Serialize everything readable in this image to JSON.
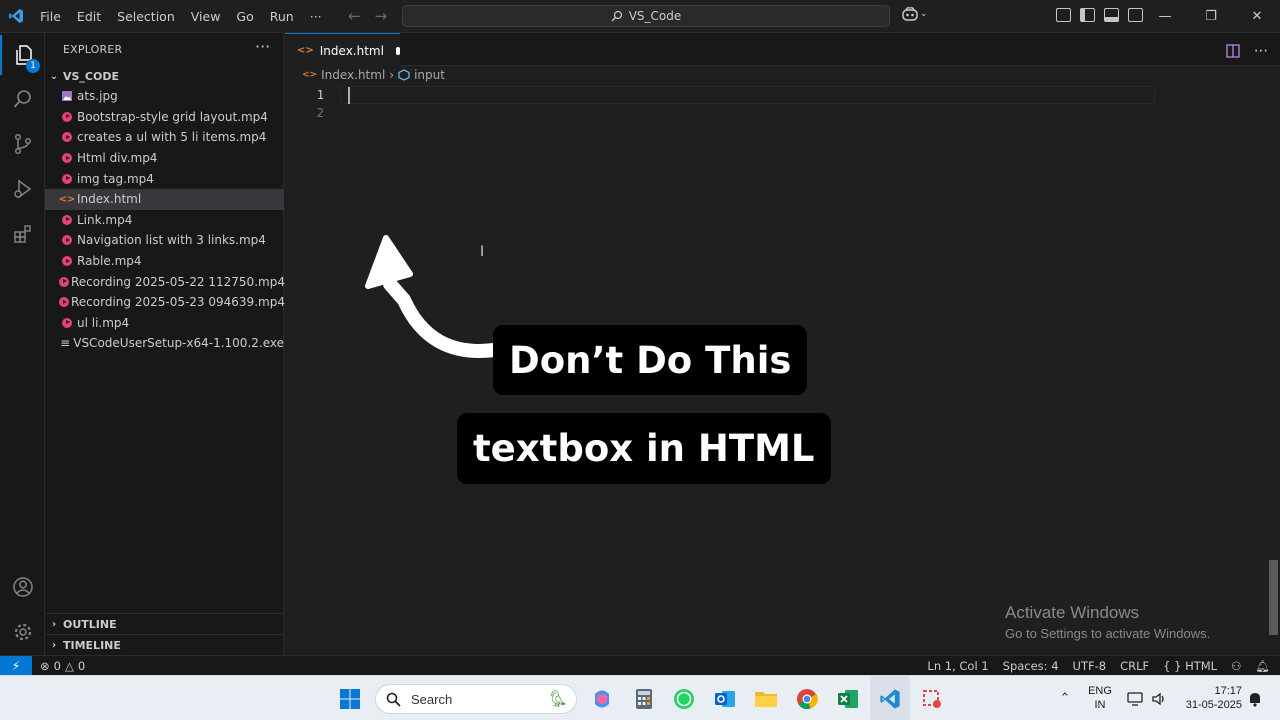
{
  "titlebar": {
    "menu": [
      "File",
      "Edit",
      "Selection",
      "View",
      "Go",
      "Run"
    ],
    "menu_more": "···",
    "command_center": "VS_Code"
  },
  "activity": {
    "explorer_badge": "1"
  },
  "sidebar": {
    "title": "EXPLORER",
    "more": "···",
    "folder": "VS_CODE",
    "files": [
      {
        "name": "ats.jpg",
        "icon": "image-file-icon"
      },
      {
        "name": "Bootstrap-style grid layout.mp4",
        "icon": "video-file-icon"
      },
      {
        "name": "creates a ul with 5 li items.mp4",
        "icon": "video-file-icon"
      },
      {
        "name": "Html div.mp4",
        "icon": "video-file-icon"
      },
      {
        "name": "img tag.mp4",
        "icon": "video-file-icon"
      },
      {
        "name": "Index.html",
        "icon": "html-file-icon"
      },
      {
        "name": "Link.mp4",
        "icon": "video-file-icon"
      },
      {
        "name": "Navigation list with 3 links.mp4",
        "icon": "video-file-icon"
      },
      {
        "name": "Rable.mp4",
        "icon": "video-file-icon"
      },
      {
        "name": "Recording 2025-05-22 112750.mp4",
        "icon": "video-file-icon"
      },
      {
        "name": "Recording 2025-05-23 094639.mp4",
        "icon": "video-file-icon"
      },
      {
        "name": "ul li.mp4",
        "icon": "video-file-icon"
      },
      {
        "name": "VSCodeUserSetup-x64-1.100.2.exe",
        "icon": "exe-file-icon"
      }
    ],
    "outline": "OUTLINE",
    "timeline": "TIMELINE"
  },
  "editor": {
    "tab_label": "Index.html",
    "breadcrumb": [
      "Index.html",
      "input"
    ],
    "line_numbers": [
      "1",
      "2"
    ]
  },
  "overlay": {
    "caption_top": "Don’t Do This",
    "caption_bottom": "textbox in HTML"
  },
  "watermark": {
    "line1": "Activate Windows",
    "line2": "Go to Settings to activate Windows."
  },
  "statusbar": {
    "errors": "0",
    "warnings": "0",
    "position": "Ln 1, Col 1",
    "spaces": "Spaces: 4",
    "encoding": "UTF-8",
    "eol": "CRLF",
    "language": "HTML",
    "language_prefix": "{ }"
  },
  "taskbar": {
    "search_placeholder": "Search",
    "lang_line1": "ENG",
    "lang_line2": "IN",
    "time": "17:17",
    "date": "31-05-2025"
  },
  "colors": {
    "accent": "#0078d4",
    "editor_bg": "#1f1f1f",
    "sidebar_bg": "#181818",
    "video_icon": "#e8407a",
    "html_icon": "#e37933"
  }
}
